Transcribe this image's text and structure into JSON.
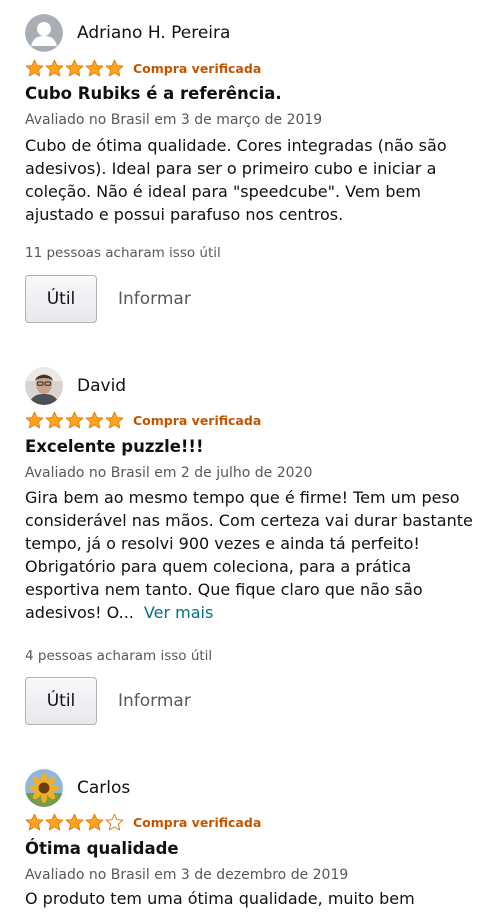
{
  "colors": {
    "star": "#ffa41c",
    "star_empty_outline": "#de7921",
    "verified": "#c45500",
    "link": "#007185",
    "muted": "#565959"
  },
  "reviews": [
    {
      "reviewer": "Adriano H. Pereira",
      "avatar_icon": "default-user-avatar-icon",
      "rating": 5,
      "verified_label": "Compra verificada",
      "title": "Cubo Rubiks é a referência.",
      "date": "Avaliado no Brasil em 3 de março de 2019",
      "body": "Cubo de ótima qualidade. Cores integradas (não são adesivos). Ideal para ser o primeiro cubo e iniciar a coleção. Não é ideal para \"speedcube\". Vem bem ajustado e possui parafuso nos centros.",
      "helpful": "11 pessoas acharam isso útil",
      "useful_label": "Útil",
      "report_label": "Informar"
    },
    {
      "reviewer": "David",
      "avatar_icon": "user-photo-avatar",
      "rating": 5,
      "verified_label": "Compra verificada",
      "title": "Excelente puzzle!!!",
      "date": "Avaliado no Brasil em 2 de julho de 2020",
      "body": "Gira bem ao mesmo tempo que é firme! Tem um peso considerável nas mãos. Com certeza vai durar bastante tempo, já o resolvi 900 vezes e ainda tá perfeito! Obrigatório para quem coleciona, para a prática esportiva nem tanto. Que fique claro que não são adesivos! O...",
      "see_more": "Ver mais",
      "helpful": "4 pessoas acharam isso útil",
      "useful_label": "Útil",
      "report_label": "Informar"
    },
    {
      "reviewer": "Carlos",
      "avatar_icon": "sunflower-photo-avatar",
      "rating": 4,
      "verified_label": "Compra verificada",
      "title": "Ótima qualidade",
      "date": "Avaliado no Brasil em 3 de dezembro de 2019",
      "body": "O produto tem uma ótima qualidade, muito bem"
    }
  ]
}
